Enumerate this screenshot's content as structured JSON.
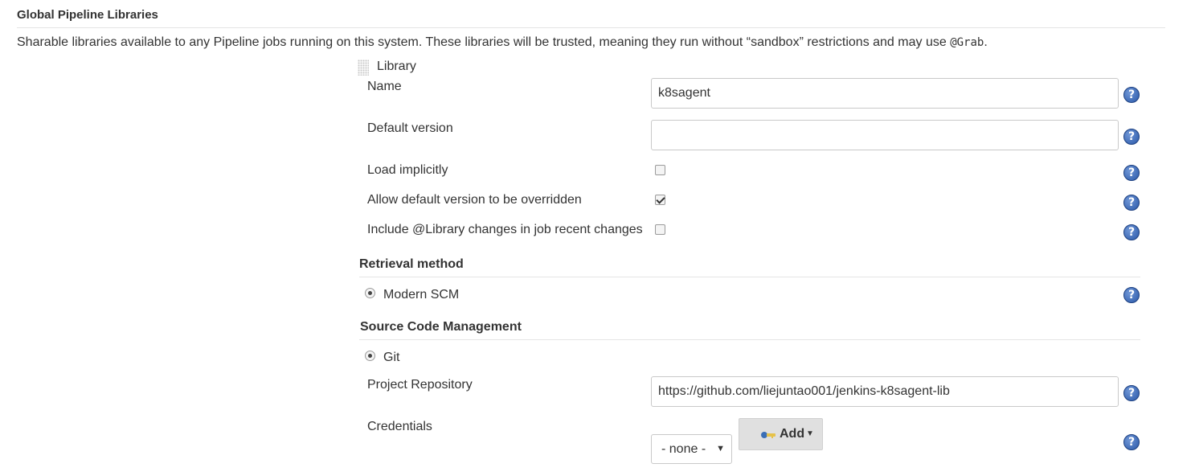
{
  "section": {
    "title": "Global Pipeline Libraries",
    "description": "Sharable libraries available to any Pipeline jobs running on this system. These libraries will be trusted, meaning they run without “sandbox” restrictions and may use ",
    "description_code": "@Grab",
    "description_end": "."
  },
  "library": {
    "header": "Library",
    "name_label": "Name",
    "name_value": "k8sagent",
    "default_version_label": "Default version",
    "default_version_value": "",
    "load_implicitly_label": "Load implicitly",
    "load_implicitly_checked": false,
    "allow_override_label": "Allow default version to be overridden",
    "allow_override_checked": true,
    "include_changes_label": "Include @Library changes in job recent changes",
    "include_changes_checked": false
  },
  "retrieval": {
    "title": "Retrieval method",
    "option_label": "Modern SCM"
  },
  "scm": {
    "title": "Source Code Management",
    "option_label": "Git",
    "repo_label": "Project Repository",
    "repo_value": "https://github.com/liejuntao001/jenkins-k8sagent-lib",
    "credentials_label": "Credentials",
    "credentials_selected": "- none -",
    "add_button_label": "Add"
  },
  "help_glyph": "?",
  "icons": {
    "help": "help-icon",
    "key": "key-icon",
    "drag": "drag-handle-icon"
  },
  "colors": {
    "help_blue": "#2a58a8",
    "button_gray": "#e0e0e0"
  }
}
